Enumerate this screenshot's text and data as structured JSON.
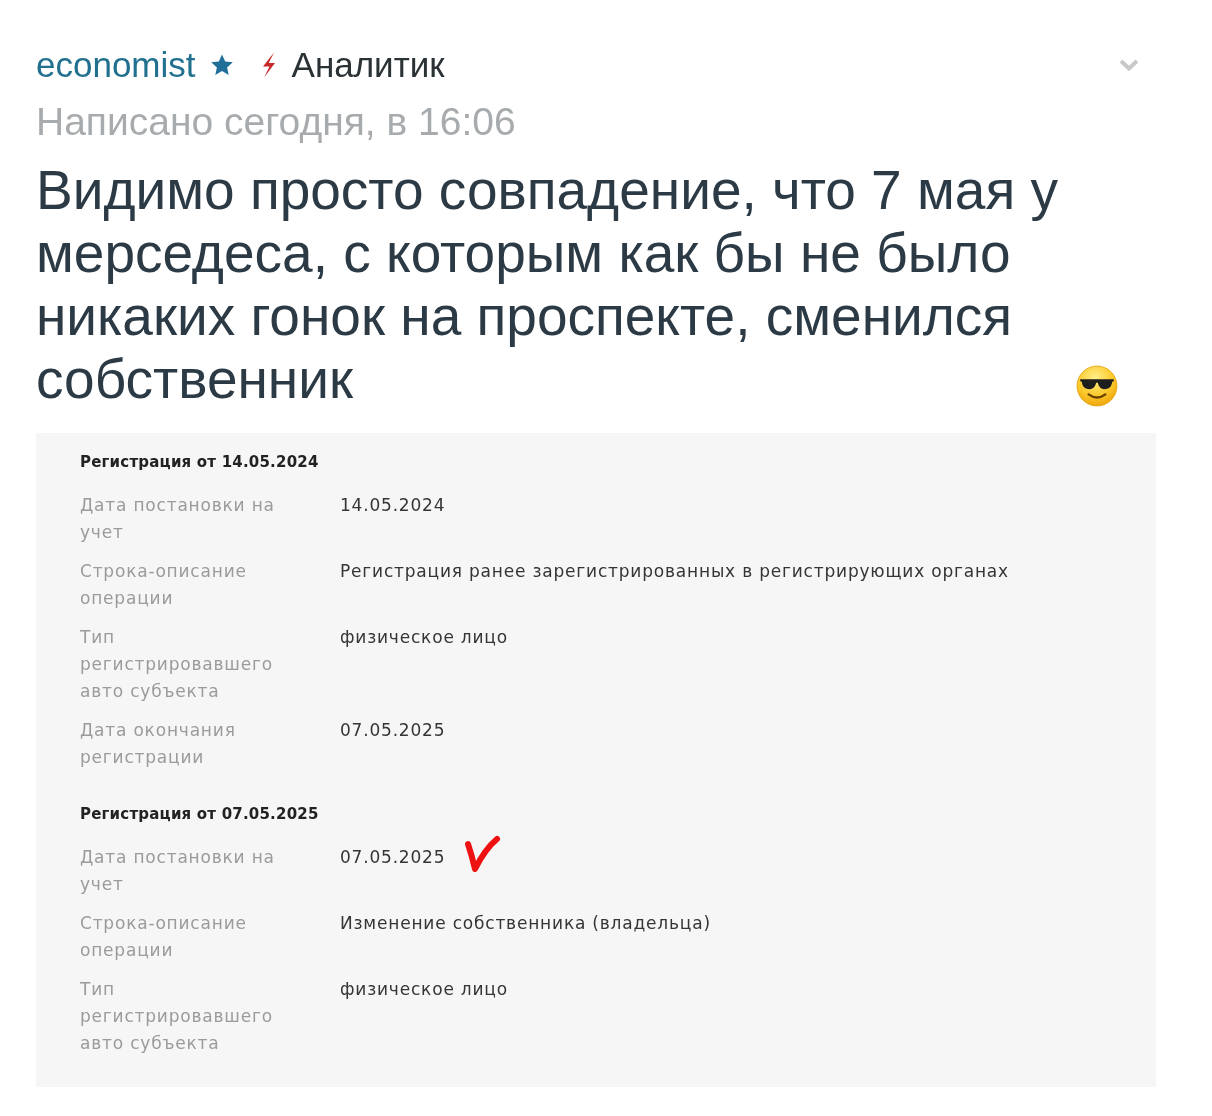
{
  "post": {
    "author": {
      "name": "economist",
      "rank": "Аналитик"
    },
    "timestamp": "Написано сегодня, в 16:06",
    "text": "Видимо просто совпадение, что 7 мая у мерседеса, с которым как бы не было никаких гонок на проспекте, сменился собственник",
    "attachment": {
      "sections": [
        {
          "title": "Регистрация от 14.05.2024",
          "rows": [
            {
              "label": "Дата постановки на учет",
              "value": "14.05.2024",
              "marked": false
            },
            {
              "label": "Строка-описание операции",
              "value": "Регистрация ранее зарегистрированных в регистрирующих органах",
              "marked": false
            },
            {
              "label": "Тип регистрировавшего авто субъекта",
              "value": "физическое лицо",
              "marked": false
            },
            {
              "label": "Дата окончания регистрации",
              "value": "07.05.2025",
              "marked": false
            }
          ]
        },
        {
          "title": "Регистрация от 07.05.2025",
          "rows": [
            {
              "label": "Дата постановки на учет",
              "value": "07.05.2025",
              "marked": true
            },
            {
              "label": "Строка-описание операции",
              "value": "Изменение собственника (владельца)",
              "marked": false
            },
            {
              "label": "Тип регистрировавшего авто субъекта",
              "value": "физическое лицо",
              "marked": false
            }
          ]
        }
      ]
    }
  }
}
